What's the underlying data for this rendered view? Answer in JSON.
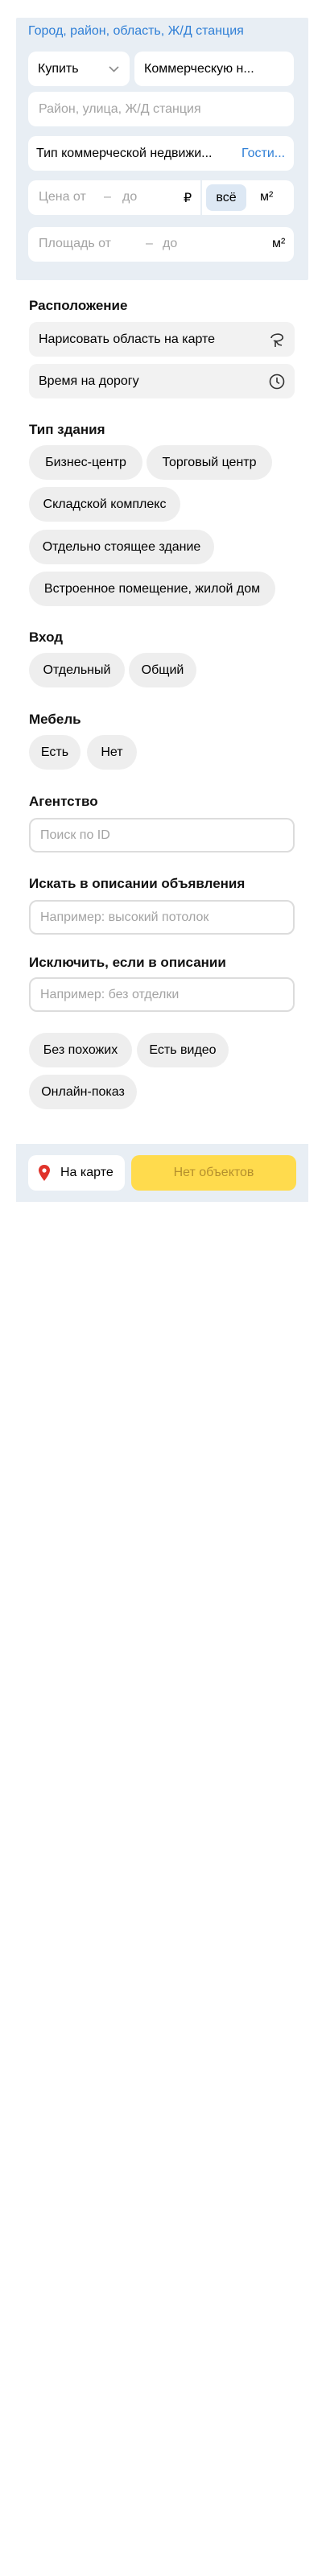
{
  "filters": {
    "region_link": "Город, район, область, Ж/Д станция",
    "deal_type": "Купить",
    "property_category": "Коммерческую н...",
    "address_placeholder": "Район, улица, Ж/Д станция",
    "commercial_type": "Тип коммерческой недвижи...",
    "commercial_type_value": "Гости...",
    "price_from_placeholder": "Цена от",
    "price_to_placeholder": "до",
    "dash": "–",
    "currency": "₽",
    "price_unit_all": "всё",
    "price_unit_sqm": "м²",
    "area_from_placeholder": "Площадь от",
    "area_to_placeholder": "до",
    "area_unit": "м²"
  },
  "location": {
    "title": "Расположение",
    "draw_area": "Нарисовать область на карте",
    "travel_time": "Время на дорогу"
  },
  "building_type": {
    "title": "Тип здания",
    "options": [
      "Бизнес-центр",
      "Торговый центр",
      "Складской комплекс",
      "Отдельно стоящее здание",
      "Встроенное помещение, жилой дом"
    ]
  },
  "entrance": {
    "title": "Вход",
    "options": [
      "Отдельный",
      "Общий"
    ]
  },
  "furniture": {
    "title": "Мебель",
    "options": [
      "Есть",
      "Нет"
    ]
  },
  "agency": {
    "title": "Агентство",
    "placeholder": "Поиск по ID"
  },
  "description_search": {
    "title": "Искать в описании объявления",
    "placeholder": "Например: высокий потолок"
  },
  "description_exclude": {
    "title": "Исключить, если в описании",
    "placeholder": "Например: без отделки"
  },
  "extras": {
    "options": [
      "Без похожих",
      "Есть видео",
      "Онлайн-показ"
    ]
  },
  "footer": {
    "map_button": "На карте",
    "submit_button": "Нет объектов"
  },
  "colors": {
    "panel_bg": "#e8eef4",
    "link": "#2f7fd6",
    "submit": "#ffdb4d",
    "pin": "#e0332b"
  },
  "icons": {
    "draw_area": "lasso-icon",
    "travel_time": "clock-icon",
    "map_pin": "map-pin-icon",
    "dropdown": "chevron-down-icon"
  }
}
